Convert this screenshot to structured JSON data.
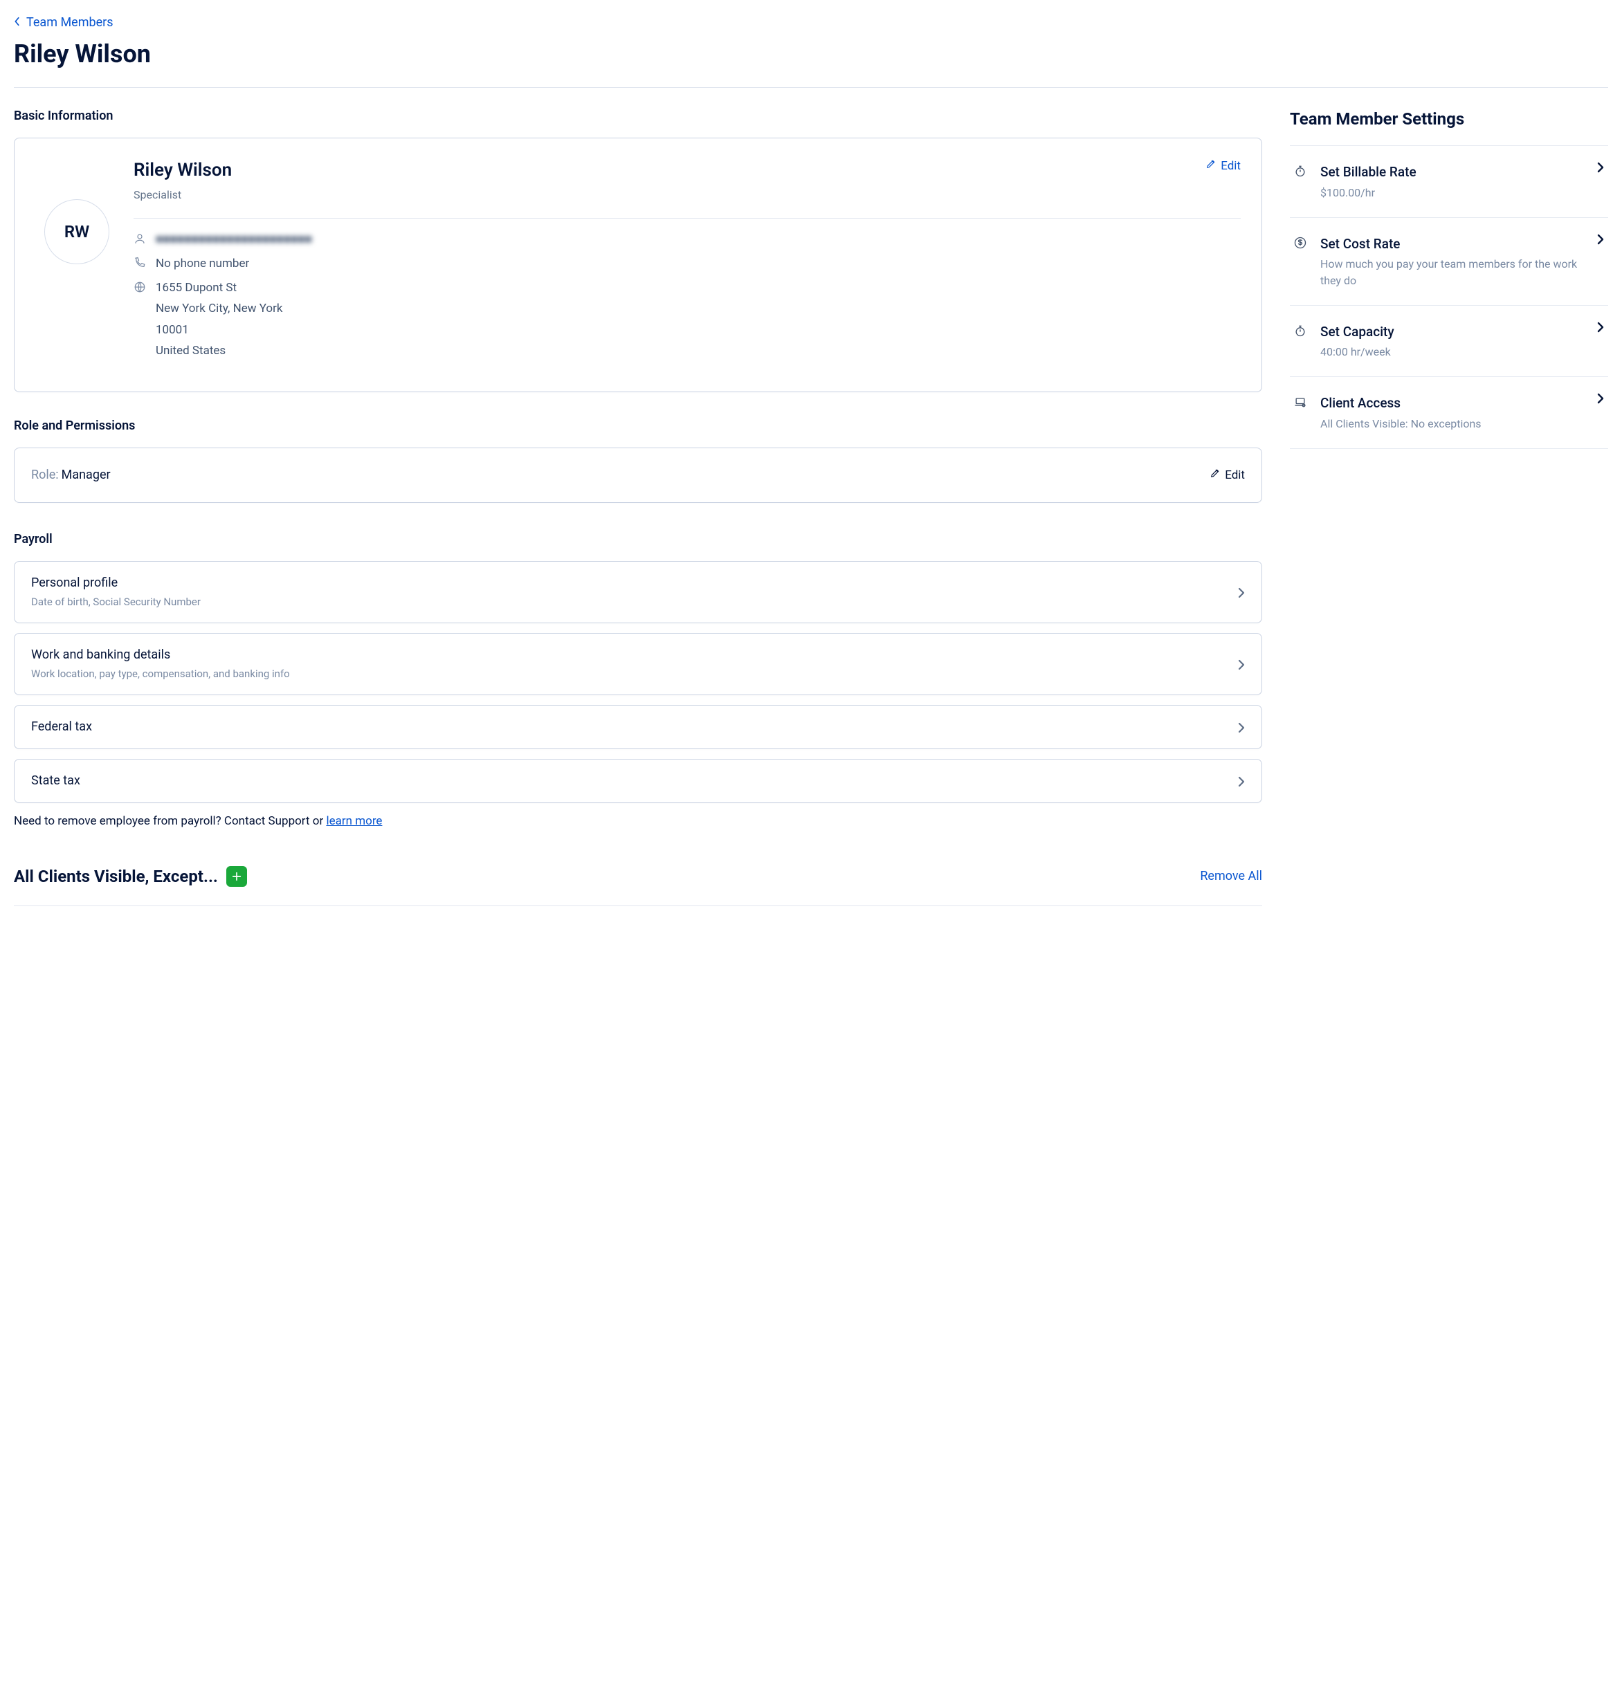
{
  "breadcrumb": {
    "label": "Team Members"
  },
  "page_title": "Riley Wilson",
  "basic_info": {
    "heading": "Basic Information",
    "avatar_initials": "RW",
    "name": "Riley Wilson",
    "subtitle": "Specialist",
    "edit_label": "Edit",
    "email_masked": "■■■■■■■■■■■■■■■■■■■■■■",
    "phone": "No phone number",
    "address_line1": "1655 Dupont St",
    "address_line2": "New York City, New York",
    "postal": "10001",
    "country": "United States"
  },
  "role": {
    "heading": "Role and Permissions",
    "label": "Role:",
    "value": "Manager",
    "edit_label": "Edit"
  },
  "payroll": {
    "heading": "Payroll",
    "items": [
      {
        "title": "Personal profile",
        "sub": "Date of birth, Social Security Number"
      },
      {
        "title": "Work and banking details",
        "sub": "Work location, pay type, compensation, and banking info"
      },
      {
        "title": "Federal tax",
        "sub": ""
      },
      {
        "title": "State tax",
        "sub": ""
      }
    ],
    "remove_note_prefix": "Need to remove employee from payroll? Contact Support or ",
    "remove_note_link": "learn more"
  },
  "clients": {
    "title": "All Clients Visible, Except...",
    "remove_all": "Remove All"
  },
  "settings": {
    "heading": "Team Member Settings",
    "items": [
      {
        "icon": "stopwatch",
        "title": "Set Billable Rate",
        "sub": "$100.00/hr"
      },
      {
        "icon": "dollar",
        "title": "Set Cost Rate",
        "sub": "How much you pay your team members for the work they do"
      },
      {
        "icon": "stopwatch",
        "title": "Set Capacity",
        "sub": "40:00 hr/week"
      },
      {
        "icon": "laptop",
        "title": "Client Access",
        "sub": "All Clients Visible: No exceptions"
      }
    ]
  }
}
